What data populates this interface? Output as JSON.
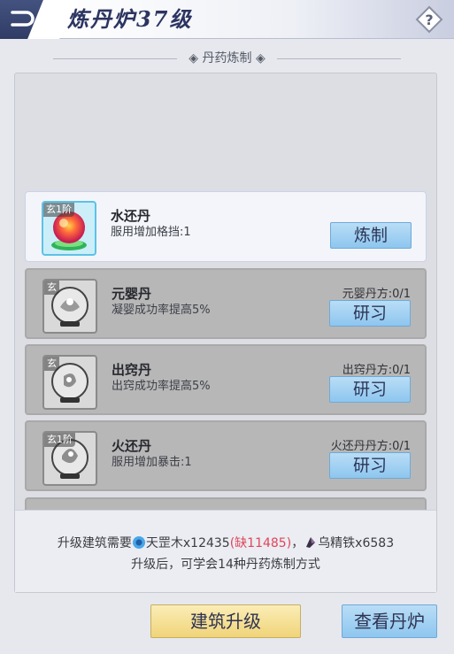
{
  "header": {
    "title": "炼丹炉37级",
    "back_icon": "back-arrow-icon",
    "help_icon": "question-mark-icon"
  },
  "section": {
    "title": "◈ 丹药炼制 ◈"
  },
  "items": [
    {
      "tier": "玄1阶",
      "name": "水还丹",
      "desc": "服用增加格挡:1",
      "recipe": "",
      "button": "炼制",
      "state": "active",
      "icon": "water-pill-icon"
    },
    {
      "tier": "玄",
      "name": "元婴丹",
      "desc": "凝婴成功率提高5%",
      "recipe": "元婴丹方:0/1",
      "button": "研习",
      "state": "locked",
      "icon": "pill-orb-icon"
    },
    {
      "tier": "玄",
      "name": "出窍丹",
      "desc": "出窍成功率提高5%",
      "recipe": "出窍丹方:0/1",
      "button": "研习",
      "state": "locked",
      "icon": "pill-orb-icon"
    },
    {
      "tier": "玄1阶",
      "name": "火还丹",
      "desc": "服用增加暴击:1",
      "recipe": "火还丹丹方:0/1",
      "button": "研习",
      "state": "locked",
      "icon": "pill-orb-icon"
    }
  ],
  "info": {
    "prefix": "升级建筑需要",
    "mat1_name": "天罡木x12435",
    "mat1_short": "(缺11485)",
    "separator": "，",
    "mat2_name": "乌精铁x6583",
    "line2": "升级后，可学会14种丹药炼制方式",
    "colors": {
      "short": "#e0455b"
    }
  },
  "buttons": {
    "upgrade": "建筑升级",
    "view": "查看丹炉"
  }
}
